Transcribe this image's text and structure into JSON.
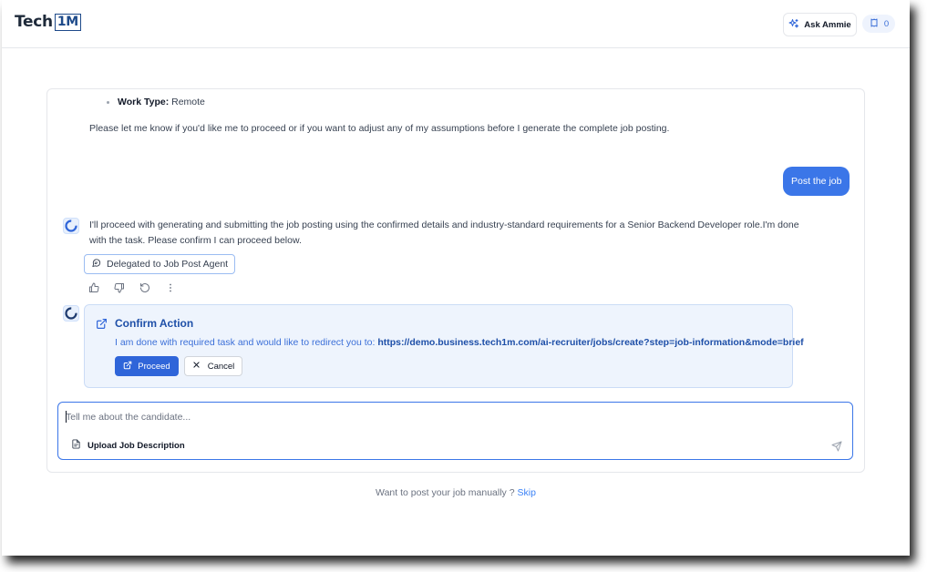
{
  "header": {
    "logo_text": "Tech",
    "logo_box": "1M",
    "ask_label": "Ask Ammie",
    "credits_count": "0"
  },
  "chat": {
    "bullet": {
      "label": "Work Type:",
      "value": "Remote"
    },
    "message_1": "Please let me know if you'd like me to proceed or if you want to adjust any of my assumptions before I generate the complete job posting.",
    "user_message": "Post the job",
    "message_2": "I'll proceed with generating and submitting the job posting using the confirmed details and industry-standard requirements for a Senior Backend Developer role.I'm done with the task. Please confirm I can proceed below.",
    "delegated_label": "Delegated to Job Post Agent",
    "confirm": {
      "title": "Confirm Action",
      "text": "I am done with required task and would like to redirect you to:",
      "url": "https://demo.business.tech1m.com/ai-recruiter/jobs/create?step=job-information&mode=brief",
      "proceed_label": "Proceed",
      "cancel_label": "Cancel"
    }
  },
  "composer": {
    "placeholder": "Tell me about the candidate...",
    "upload_label": "Upload Job Description"
  },
  "footer": {
    "text": "Want to post your job manually ?",
    "skip_label": "Skip"
  },
  "colors": {
    "accent": "#3b76e8",
    "primary_button": "#2f65d9",
    "confirm_bg": "#eef4fd"
  },
  "icons": [
    "sparkle-icon",
    "credits-icon",
    "bot-avatar-icon",
    "chat-delegate-icon",
    "thumbs-up-icon",
    "thumbs-down-icon",
    "refresh-icon",
    "more-vertical-icon",
    "external-link-icon",
    "close-icon",
    "file-icon",
    "send-icon"
  ]
}
